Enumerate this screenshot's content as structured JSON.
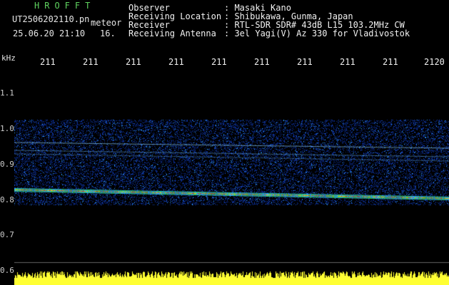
{
  "header": {
    "app_title": "HROFFT",
    "filename": "UT2506202110.pn",
    "filename_suffix": "meteor",
    "datetime": "25.06.20 21:10",
    "count": "16."
  },
  "info": [
    {
      "label": "Observer",
      "value": ": Masaki Kano"
    },
    {
      "label": "Receiving Location",
      "value": ": Shibukawa, Gunma, Japan"
    },
    {
      "label": "Receiver",
      "value": ": RTL-SDR SDR# 43dB L15 103.2MHz CW"
    },
    {
      "label": "Receiving Antenna",
      "value": ": 3el Yagi(V) Az 330 for Vladivostok"
    }
  ],
  "axis": {
    "unit": "kHz",
    "y_ticks": [
      "1.1",
      "1.0",
      "0.9",
      "0.8",
      "0.7",
      "0.6"
    ],
    "x_ticks": [
      "211",
      "211",
      "211",
      "211",
      "211",
      "211",
      "211",
      "211",
      "211",
      "2120"
    ]
  },
  "colors": {
    "background": "#000000",
    "title": "#5fd35f",
    "signal_low": "#0a2a8a",
    "signal_mid": "#2fa0ff",
    "signal_high": "#ffd000",
    "bottom_bars": "#ffff33"
  }
}
